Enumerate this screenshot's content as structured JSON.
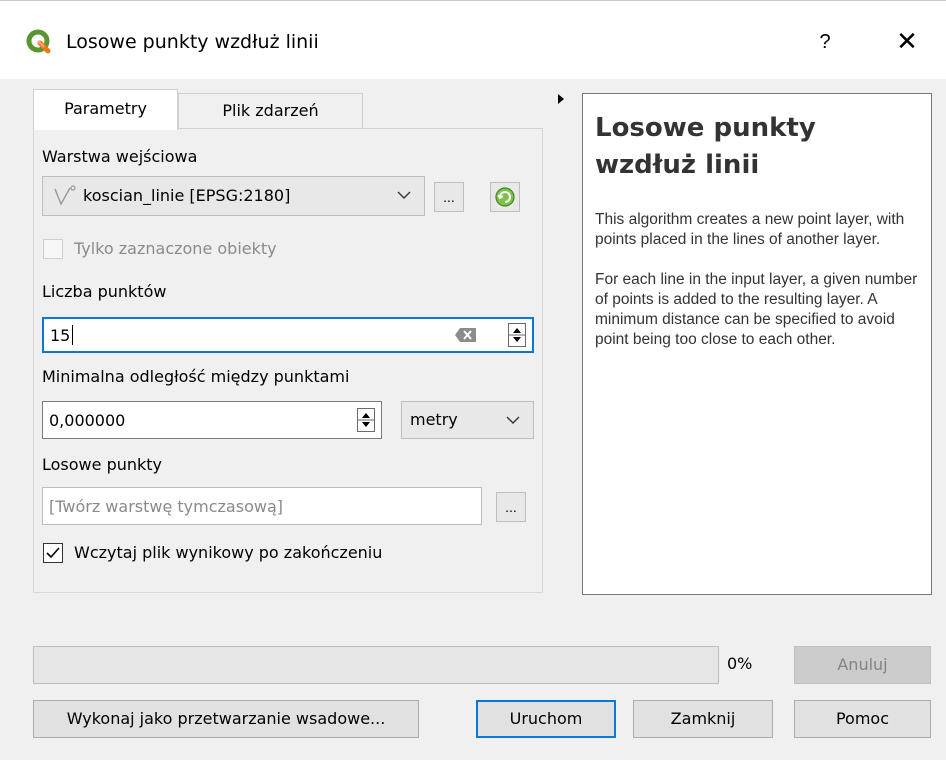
{
  "window": {
    "title": "Losowe punkty wzdłuż linii",
    "help_glyph": "?",
    "close_glyph": "✕"
  },
  "tabs": [
    {
      "label": "Parametry",
      "active": true
    },
    {
      "label": "Plik zdarzeń",
      "active": false
    }
  ],
  "params": {
    "input_layer_label": "Warstwa wejściowa",
    "input_layer_value": "koscian_linie [EPSG:2180]",
    "browse_label": "...",
    "selected_only_label": "Tylko zaznaczone obiekty",
    "selected_only_checked": false,
    "count_label": "Liczba punktów",
    "count_value": "15",
    "min_distance_label": "Minimalna odległość między punktami",
    "min_distance_value": "0,000000",
    "unit_value": "metry",
    "output_label": "Losowe punkty",
    "output_placeholder": "[Twórz warstwę tymczasową]",
    "open_output_label": "Wczytaj plik wynikowy po zakończeniu",
    "open_output_checked": true
  },
  "help": {
    "title": "Losowe punkty wzdłuż linii",
    "paragraphs": [
      "This algorithm creates a new point layer, with points placed in the lines of another layer.",
      "For each line in the input layer, a given number of points is added to the resulting layer. A minimum distance can be specified to avoid point being too close to each other."
    ]
  },
  "progress": {
    "percent_text": "0%",
    "value": 0
  },
  "buttons": {
    "cancel": "Anuluj",
    "batch": "Wykonaj jako przetwarzanie wsadowe...",
    "run": "Uruchom",
    "close": "Zamknij",
    "help": "Pomoc"
  },
  "colors": {
    "accent": "#0a78d7",
    "qgis_green": "#589632",
    "qgis_yellow": "#ee7913"
  },
  "icons": {
    "app": "qgis-logo-icon",
    "layer_type": "line-layer-icon",
    "iterate": "iterate-icon",
    "clear": "clear-text-icon"
  }
}
